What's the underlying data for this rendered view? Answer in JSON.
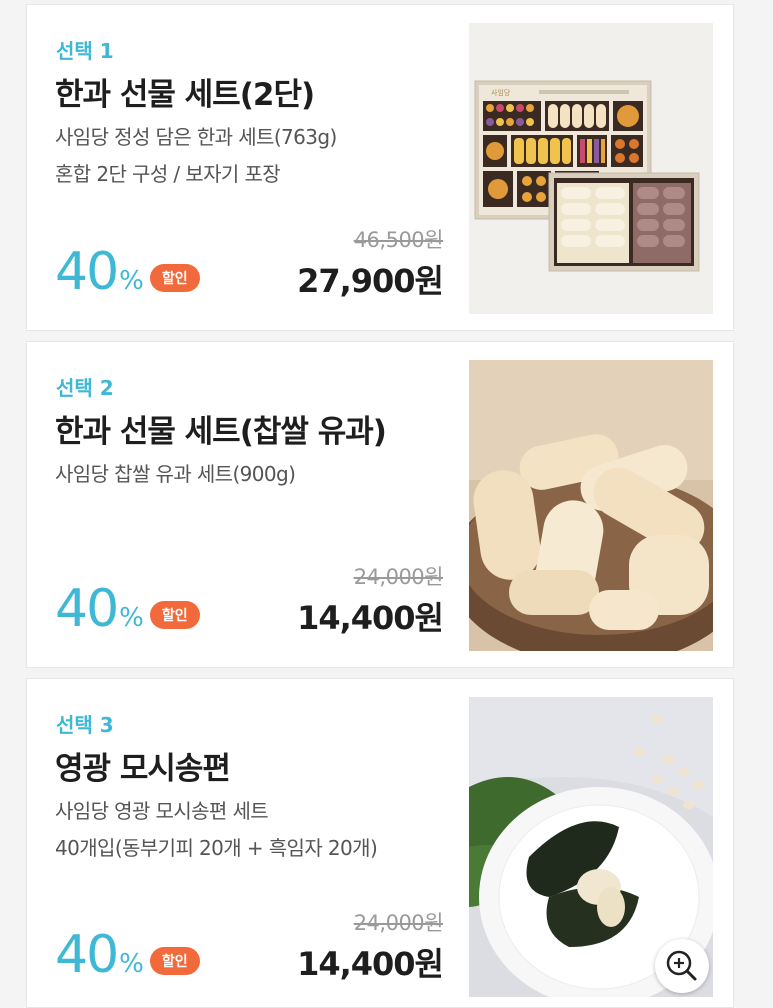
{
  "products": [
    {
      "select_label": "선택 1",
      "name": "한과 선물 세트(2단)",
      "desc_line1": "사임당 정성 담은 한과 세트(763g)",
      "desc_line2": "혼합 2단 구성 / 보자기 포장",
      "discount_number": "40",
      "discount_unit": "%",
      "discount_badge": "할인",
      "original_price": "46,500원",
      "sale_price": "27,900원",
      "box_logo": "사임당",
      "image_icon": "hangwa-gift-box-image"
    },
    {
      "select_label": "선택 2",
      "name": "한과 선물 세트(찹쌀 유과)",
      "desc_line1": "사임당 찹쌀 유과 세트(900g)",
      "desc_line2": "",
      "discount_number": "40",
      "discount_unit": "%",
      "discount_badge": "할인",
      "original_price": "24,000원",
      "sale_price": "14,400원",
      "image_icon": "yugwa-bowl-image"
    },
    {
      "select_label": "선택 3",
      "name": "영광 모시송편",
      "desc_line1": "사임당 영광 모시송편 세트",
      "desc_line2": "40개입(동부기피 20개 + 흑임자 20개)",
      "discount_number": "40",
      "discount_unit": "%",
      "discount_badge": "할인",
      "original_price": "24,000원",
      "sale_price": "14,400원",
      "image_icon": "mosi-songpyeon-plate-image",
      "zoom_icon": "zoom-in-icon"
    }
  ],
  "colors": {
    "accent_cyan": "#3fb8d6",
    "badge_orange": "#f26a3b",
    "text_dark": "#1e1e1e",
    "text_gray": "#555555",
    "strike_gray": "#9a9a9a"
  }
}
